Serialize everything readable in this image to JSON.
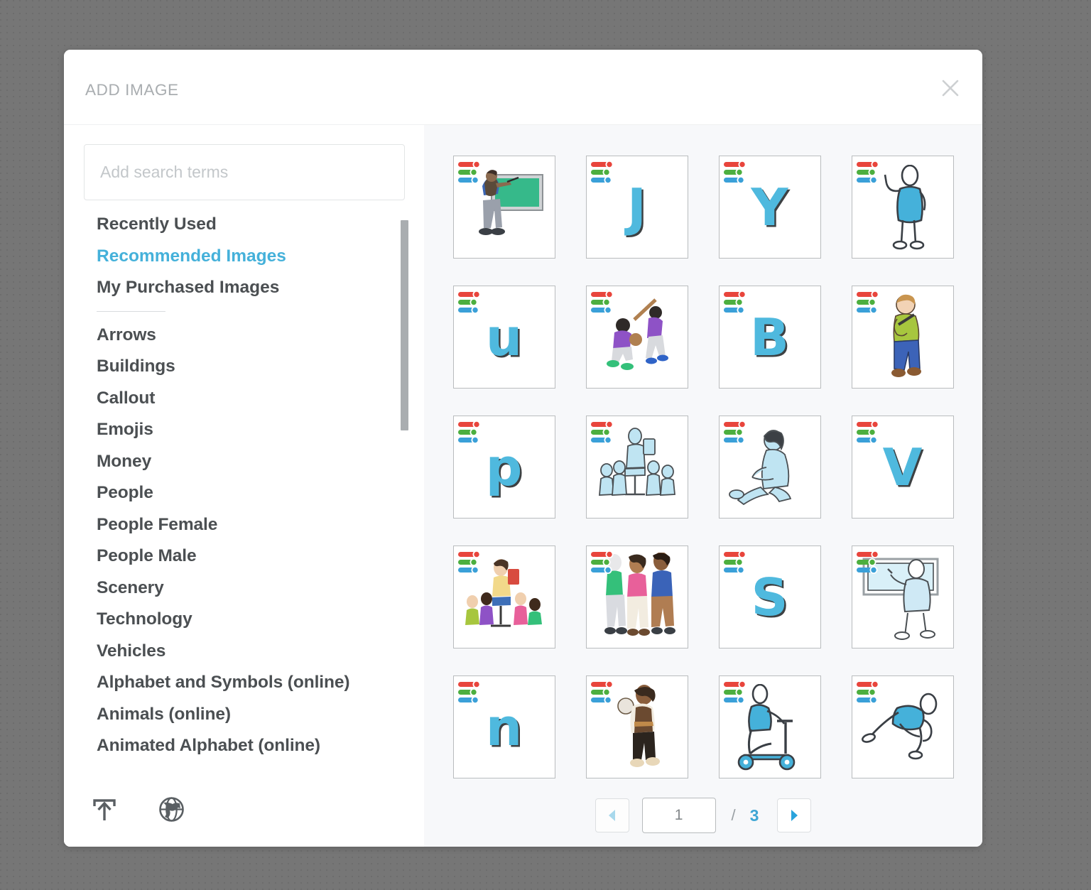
{
  "dialog": {
    "title": "ADD IMAGE",
    "close_label": "close-icon"
  },
  "search": {
    "value": "",
    "placeholder": "Add search terms"
  },
  "sidebar": {
    "primary_items": [
      {
        "label": "Recently Used",
        "active": false
      },
      {
        "label": "Recommended Images",
        "active": true
      },
      {
        "label": "My Purchased Images",
        "active": false
      }
    ],
    "categories": [
      {
        "label": "Arrows"
      },
      {
        "label": "Buildings"
      },
      {
        "label": "Callout"
      },
      {
        "label": "Emojis"
      },
      {
        "label": "Money"
      },
      {
        "label": "People"
      },
      {
        "label": "People Female"
      },
      {
        "label": "People Male"
      },
      {
        "label": "Scenery"
      },
      {
        "label": "Technology"
      },
      {
        "label": "Vehicles"
      },
      {
        "label": "Alphabet and Symbols (online)"
      },
      {
        "label": "Animals (online)"
      },
      {
        "label": "Animated Alphabet (online)"
      }
    ],
    "footer_icons": [
      {
        "name": "upload-icon"
      },
      {
        "name": "globe-icon"
      }
    ]
  },
  "gallery": {
    "thumbnails": [
      {
        "kind": "art",
        "name": "teacher-at-chalkboard"
      },
      {
        "kind": "glyph",
        "name": "letter-j",
        "glyph": "J"
      },
      {
        "kind": "glyph",
        "name": "letter-y",
        "glyph": "Y"
      },
      {
        "kind": "art",
        "name": "person-raising-hand"
      },
      {
        "kind": "glyph",
        "name": "letter-u-lowercase",
        "glyph": "u"
      },
      {
        "kind": "art",
        "name": "baseball-batter-and-catcher"
      },
      {
        "kind": "glyph",
        "name": "letter-b",
        "glyph": "B"
      },
      {
        "kind": "art",
        "name": "boy-playing-flute"
      },
      {
        "kind": "glyph",
        "name": "letter-p-lowercase",
        "glyph": "p"
      },
      {
        "kind": "art",
        "name": "teacher-reading-to-children-outline"
      },
      {
        "kind": "art",
        "name": "girl-reading-seated-outline"
      },
      {
        "kind": "glyph",
        "name": "letter-v",
        "glyph": "V"
      },
      {
        "kind": "art",
        "name": "teacher-reading-to-children-color"
      },
      {
        "kind": "art",
        "name": "three-people-standing"
      },
      {
        "kind": "glyph",
        "name": "letter-s",
        "glyph": "S"
      },
      {
        "kind": "art",
        "name": "presenter-at-whiteboard-outline"
      },
      {
        "kind": "glyph",
        "name": "letter-n-lowercase",
        "glyph": "n"
      },
      {
        "kind": "art",
        "name": "person-playing-drum"
      },
      {
        "kind": "art",
        "name": "person-on-scooter"
      },
      {
        "kind": "art",
        "name": "person-stretching"
      }
    ],
    "badge_icon": "color-sliders-icon"
  },
  "pagination": {
    "prev_label": "previous-page",
    "next_label": "next-page",
    "current_page": "1",
    "separator": "/",
    "total_pages": "3"
  },
  "colors": {
    "accent": "#45b1da",
    "text": "#4b4f52",
    "muted": "#a9adb0",
    "panel_bg": "#f7f8fa",
    "backdrop": "#767676"
  }
}
